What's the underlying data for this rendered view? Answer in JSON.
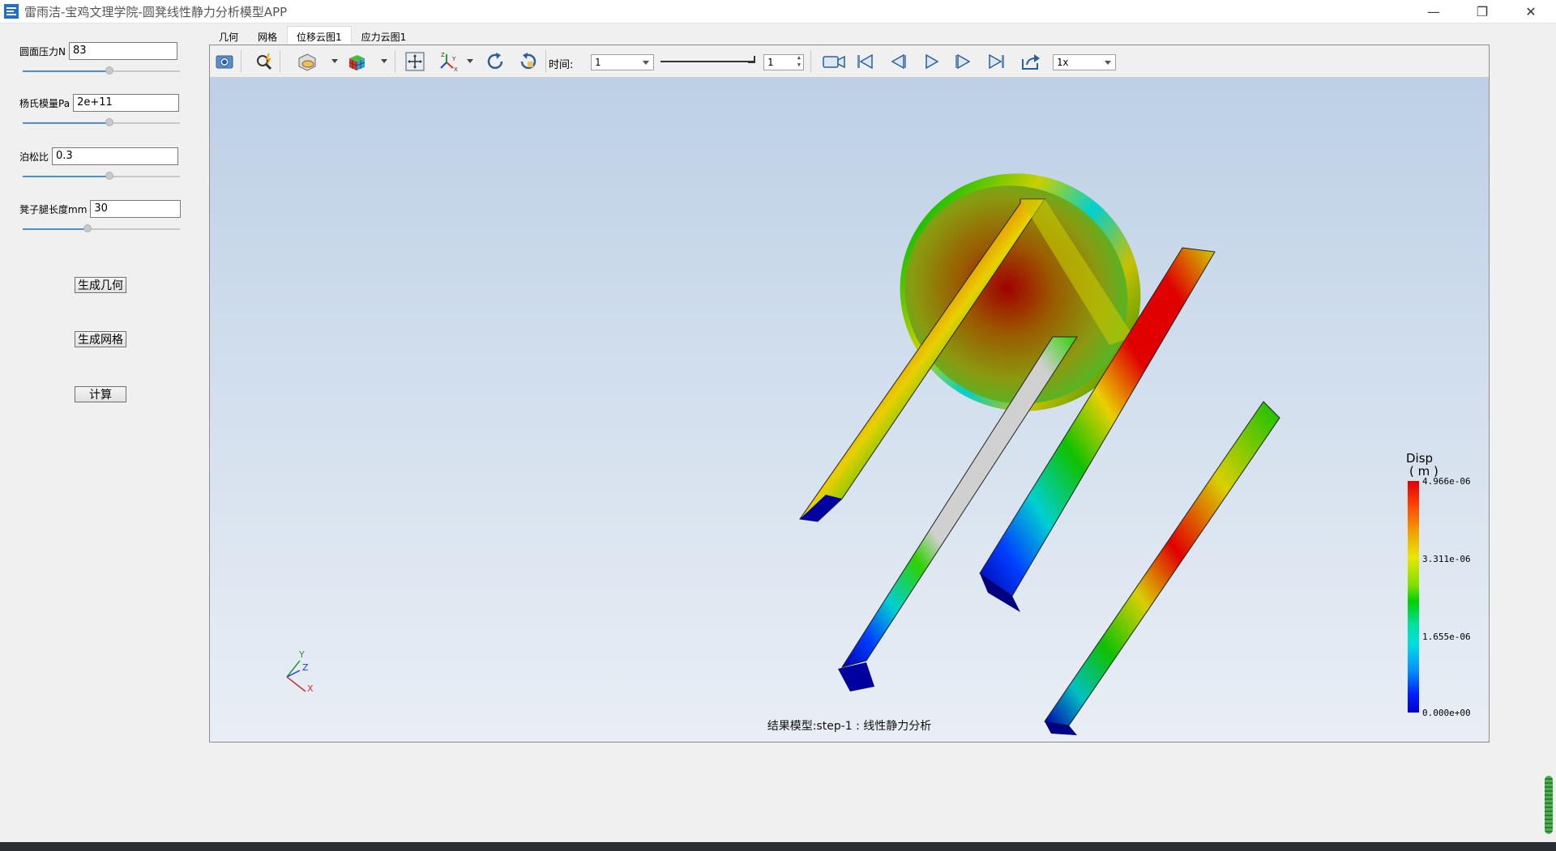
{
  "window": {
    "title": "雷雨洁-宝鸡文理学院-圆凳线性静力分析模型APP",
    "minimize_glyph": "—",
    "restore_glyph": "❐",
    "close_glyph": "✕"
  },
  "params": [
    {
      "label": "圆面压力N",
      "value": "83",
      "slider_fraction": 0.55
    },
    {
      "label": "杨氏模量Pa",
      "value": "2e+11",
      "slider_fraction": 0.55
    },
    {
      "label": "泊松比",
      "value": "0.3",
      "slider_fraction": 0.55
    },
    {
      "label": "凳子腿长度mm",
      "value": "30",
      "slider_fraction": 0.41
    }
  ],
  "buttons": {
    "generate_geometry": "生成几何",
    "generate_mesh": "生成网格",
    "compute": "计算"
  },
  "tabs": [
    {
      "label": "几何",
      "active": false
    },
    {
      "label": "网格",
      "active": false
    },
    {
      "label": "位移云图1",
      "active": true
    },
    {
      "label": "应力云图1",
      "active": false
    }
  ],
  "toolbar": {
    "time_label": "时间:",
    "time_value": "1",
    "step_value": "1",
    "speed_value": "1x",
    "icons": [
      "camera-icon",
      "zoom-search-icon",
      "display-mode-icon",
      "color-cube-icon",
      "fit-view-icon",
      "axes-orient-icon",
      "rotate-cw-icon",
      "rotate-ccw-icon",
      "record-video-icon",
      "first-frame-icon",
      "prev-frame-icon",
      "play-icon",
      "next-frame-icon",
      "last-frame-icon",
      "export-icon"
    ]
  },
  "viewport": {
    "result_label": "结果模型:step-1 : 线性静力分析",
    "axes": {
      "x": "X",
      "y": "Y",
      "z": "Z"
    }
  },
  "legend": {
    "title": "Disp",
    "unit": "( m )",
    "max": "4.966e-06",
    "v2": "3.311e-06",
    "v1": "1.655e-06",
    "min": "0.000e+00"
  },
  "colors": {
    "accent": "#4a8fd6",
    "red": "#e00000",
    "blue": "#0000c8"
  }
}
